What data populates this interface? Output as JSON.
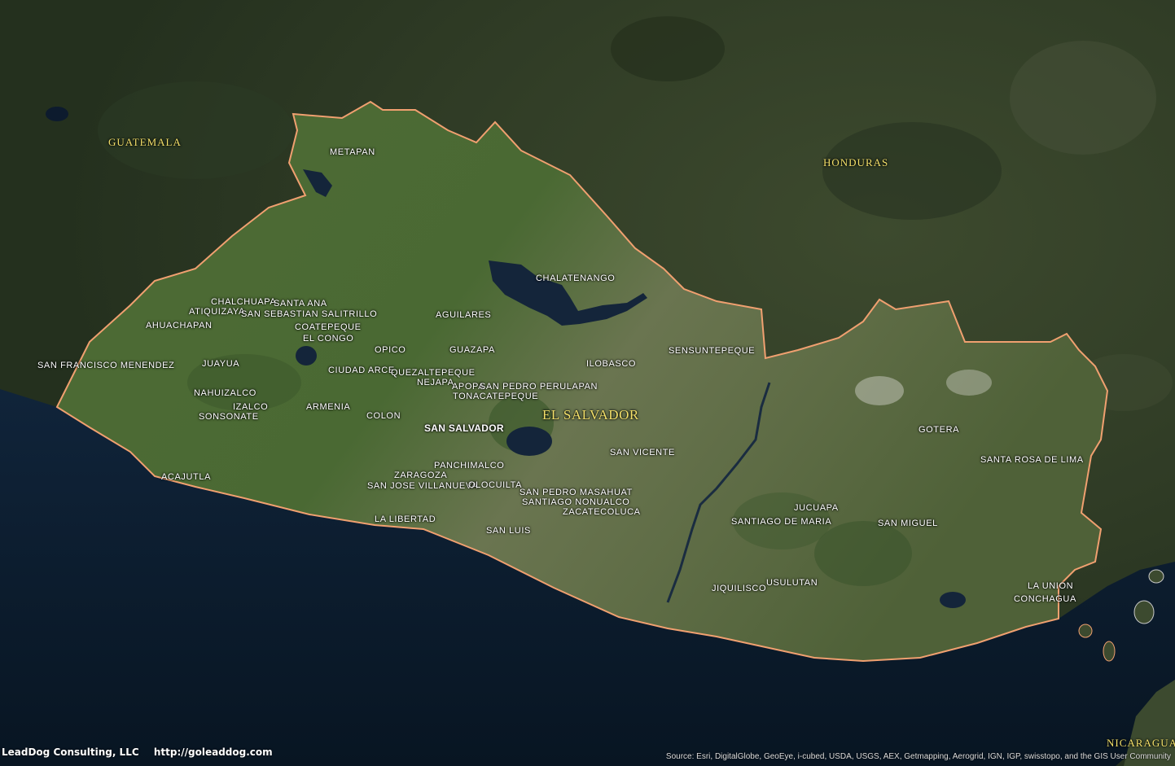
{
  "map": {
    "countries": {
      "guatemala": "GUATEMALA",
      "honduras": "HONDURAS",
      "el_salvador": "EL SALVADOR",
      "nicaragua": "NICARAGUA"
    },
    "places": {
      "metapan": "METAPAN",
      "chalatenango": "CHALATENANGO",
      "chalchuapa": "CHALCHUAPA",
      "santa_ana": "SANTA ANA",
      "atiquizaya": "ATIQUIZAYA",
      "san_sebastian_salitrillo": "SAN SEBASTIAN SALITRILLO",
      "aguilares": "AGUILARES",
      "ahuachapan": "AHUACHAPAN",
      "coatepeque": "COATEPEQUE",
      "el_congo": "EL CONGO",
      "opico": "OPICO",
      "guazapa": "GUAZAPA",
      "sensuntepeque": "SENSUNTEPEQUE",
      "san_francisco_menendez": "SAN FRANCISCO MENENDEZ",
      "juayua": "JUAYUA",
      "ilobasco": "ILOBASCO",
      "ciudad_arce": "CIUDAD ARCE",
      "quezaltepeque": "QUEZALTEPEQUE",
      "nejapa": "NEJAPA",
      "apopa": "APOPA",
      "san_pedro_perulapan": "SAN PEDRO PERULAPAN",
      "nahuizalco": "NAHUIZALCO",
      "tonacatepeque": "TONACATEPEQUE",
      "izalco": "IZALCO",
      "armenia": "ARMENIA",
      "sonsonate": "SONSONATE",
      "colon": "COLON",
      "san_salvador": "SAN SALVADOR",
      "gotera": "GOTERA",
      "san_vicente": "SAN VICENTE",
      "santa_rosa_de_lima": "SANTA ROSA DE LIMA",
      "panchimalco": "PANCHIMALCO",
      "acajutla": "ACAJUTLA",
      "zaragoza": "ZARAGOZA",
      "san_jose_villanueva": "SAN JOSE VILLANUEVA",
      "olocuilta": "OLOCUILTA",
      "san_pedro_masahuat": "SAN PEDRO MASAHUAT",
      "santiago_nonualco": "SANTIAGO NONUALCO",
      "jucuapa": "JUCUAPA",
      "zacatecoluca": "ZACATECOLUCA",
      "la_libertad": "LA LIBERTAD",
      "santiago_de_maria": "SANTIAGO DE MARIA",
      "san_miguel": "SAN MIGUEL",
      "san_luis": "SAN LUIS",
      "usulutan": "USULUTAN",
      "la_union": "LA UNION",
      "jiquilisco": "JIQUILISCO",
      "conchagua": "CONCHAGUA"
    },
    "colors": {
      "border": "#f0a070",
      "country_label": "#f3e06a",
      "ocean": "#0b1a2a"
    }
  },
  "footer": {
    "company": "LeadDog Consulting, LLC",
    "url": "http://goleaddog.com",
    "attribution": "Source: Esri, DigitalGlobe, GeoEye, i-cubed, USDA, USGS, AEX, Getmapping, Aerogrid, IGN, IGP, swisstopo, and the GIS User Community"
  }
}
